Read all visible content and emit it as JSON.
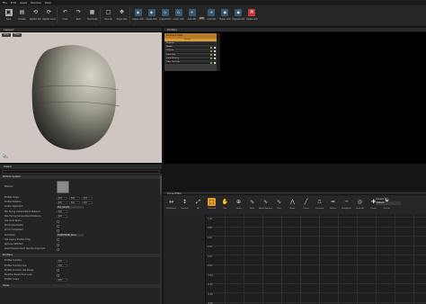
{
  "menu": [
    "File",
    "Edit",
    "Asset",
    "Window",
    "Help"
  ],
  "toolbar": {
    "buttons": [
      {
        "label": "Save",
        "icon": "save-icon"
      },
      {
        "label": "Browse",
        "icon": "browse-icon"
      },
      {
        "label": "Restart Sim",
        "icon": "restart-sim-icon"
      },
      {
        "label": "Restart Level",
        "icon": "restart-level-icon"
      },
      {
        "label": "Undo",
        "icon": "undo-icon"
      },
      {
        "label": "Redo",
        "icon": "redo-icon"
      },
      {
        "label": "Thumbnail",
        "icon": "thumbnail-icon"
      },
      {
        "label": "Bounds",
        "icon": "bounds-icon"
      },
      {
        "label": "Origin Axis",
        "icon": "origin-axis-icon"
      },
      {
        "label": "Regen LOD",
        "icon": "regen-lod-icon"
      },
      {
        "label": "Regen LOD",
        "icon": "regen-lod-icon"
      },
      {
        "label": "Lowest LOD",
        "icon": "lowest-lod-icon"
      },
      {
        "label": "Lower LOD",
        "icon": "lower-lod-icon"
      },
      {
        "label": "Add LOD",
        "icon": "add-lod-icon"
      },
      {
        "label": "Add LOD",
        "icon": "add-lod-icon"
      },
      {
        "label": "Higher LOD",
        "icon": "higher-lod-icon"
      },
      {
        "label": "Highest LOD",
        "icon": "highest-lod-icon"
      },
      {
        "label": "Delete LOD",
        "icon": "delete-lod-icon"
      }
    ],
    "lod_label": "LOD",
    "lod_value": "0"
  },
  "viewport": {
    "tab": "Viewport",
    "view_button": "View",
    "time_button": "Time"
  },
  "details": {
    "tab": "Details",
    "sections": [
      {
        "title": "Particle System"
      },
      {
        "title": "Emitters"
      },
      {
        "title": "Delay"
      }
    ],
    "thumbnail_label": "Material",
    "props_ps": [
      "Emitter Origin",
      "Emitter Rotation",
      "Screen Alignment",
      "Min Facing Camera Blend Distance",
      "Max Facing Camera Blend Distance",
      "Use Local Space",
      "Kill On Deactivate",
      "Kill On Completed",
      "Sort Mode",
      "Use Legacy Emitter Time",
      "Remove HMD Roll",
      "Used Module Inherit Velocity Alignment"
    ],
    "props_em": [
      "Emitter Duration",
      "Emitter Duration Low",
      "Emitter Duration Use Range",
      "Duration Recalc Each Loop",
      "Emitter Loops"
    ],
    "values": [
      "0.0",
      "0.0",
      "0.0",
      "0.0",
      "0.0",
      "0.0",
      "0.0",
      "0.0"
    ],
    "sort_value": "PSORTMODE_None",
    "screen_align": "PSA_Square"
  },
  "emitters": {
    "tab": "Emitters",
    "emitter_name": "Particle Emitter",
    "emitter_sub": "Emitter",
    "modules": [
      "Required",
      "Spawn",
      "Lifetime",
      "Initial Size",
      "Initial Velocity",
      "Color Over Life"
    ]
  },
  "curve_editor": {
    "tab": "Curve Editor",
    "tools": [
      {
        "label": "Horizontal",
        "icon": "horizontal-icon"
      },
      {
        "label": "Vertical",
        "icon": "vertical-icon"
      },
      {
        "label": "All",
        "icon": "all-icon"
      },
      {
        "label": "Selected",
        "icon": "selected-icon"
      },
      {
        "label": "Pan",
        "icon": "pan-icon"
      },
      {
        "label": "Zoom",
        "icon": "zoom-icon"
      },
      {
        "label": "Auto",
        "icon": "auto-icon"
      },
      {
        "label": "Auto/Clamped",
        "icon": "auto-clamped-icon"
      },
      {
        "label": "User",
        "icon": "user-icon"
      },
      {
        "label": "Break",
        "icon": "break-icon"
      },
      {
        "label": "Linear",
        "icon": "linear-icon"
      },
      {
        "label": "Constant",
        "icon": "constant-icon"
      },
      {
        "label": "Flatten",
        "icon": "flatten-icon"
      },
      {
        "label": "Straighten",
        "icon": "straighten-icon"
      },
      {
        "label": "Show All",
        "icon": "show-all-icon"
      },
      {
        "label": "Create",
        "icon": "create-icon"
      },
      {
        "label": "Delete",
        "icon": "delete-icon"
      }
    ],
    "current_tab_label": "Current Tab:",
    "current_tab_value": "Default",
    "grid_labels": [
      "1.00",
      "0.80",
      "0.60",
      "0.40",
      "0.20",
      "0.00",
      "-0.20",
      "-0.40",
      "-0.60",
      "-0.80"
    ]
  }
}
